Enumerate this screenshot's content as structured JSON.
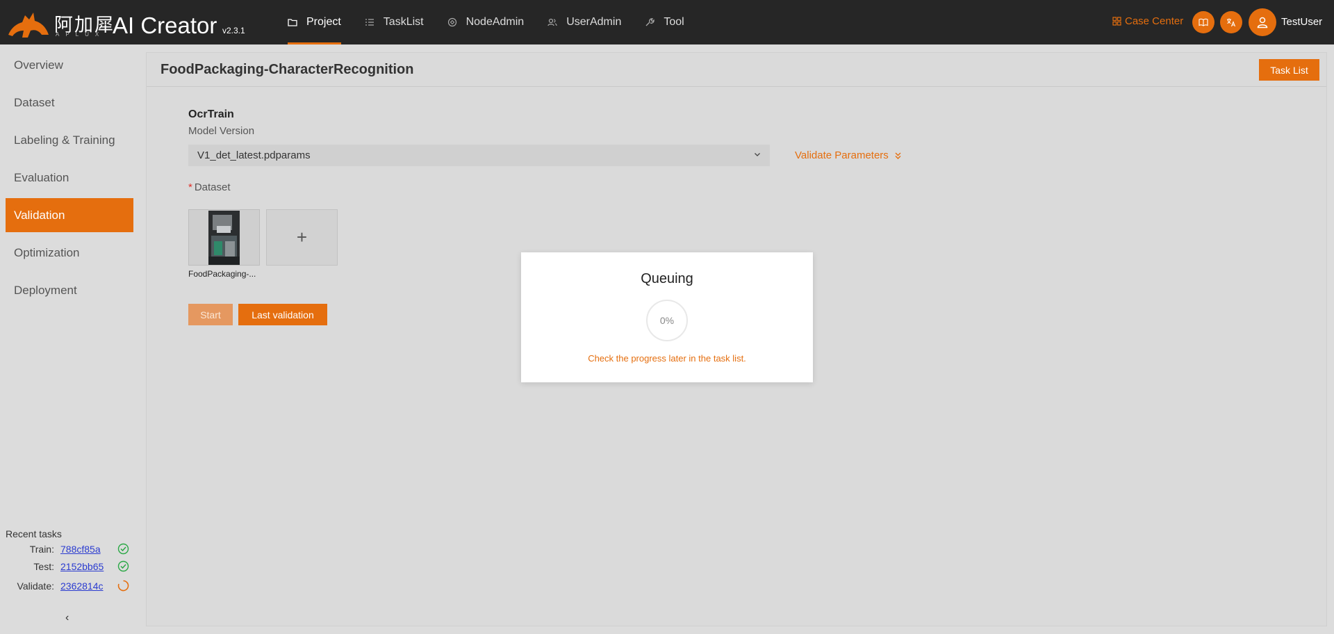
{
  "header": {
    "logo_cn": "阿加犀",
    "logo_sub": "APLUX",
    "app_title": "AI Creator",
    "version": "v2.3.1",
    "nav": [
      {
        "label": "Project",
        "icon": "folder-icon",
        "active": true
      },
      {
        "label": "TaskList",
        "icon": "tasklist-icon",
        "active": false
      },
      {
        "label": "NodeAdmin",
        "icon": "node-icon",
        "active": false
      },
      {
        "label": "UserAdmin",
        "icon": "users-icon",
        "active": false
      },
      {
        "label": "Tool",
        "icon": "wrench-icon",
        "active": false
      }
    ],
    "case_center": "Case Center",
    "username": "TestUser",
    "accent_color": "#e56e0e"
  },
  "sidebar": {
    "items": [
      {
        "label": "Overview"
      },
      {
        "label": "Dataset"
      },
      {
        "label": "Labeling & Training"
      },
      {
        "label": "Evaluation"
      },
      {
        "label": "Validation",
        "active": true
      },
      {
        "label": "Optimization"
      },
      {
        "label": "Deployment"
      }
    ],
    "recent_title": "Recent tasks",
    "recent": [
      {
        "label": "Train:",
        "id": "788cf85a",
        "status": "done"
      },
      {
        "label": "Test:",
        "id": "2152bb65",
        "status": "done"
      },
      {
        "label": "Validate:",
        "id": "2362814c",
        "status": "running"
      }
    ],
    "collapse": "‹"
  },
  "main": {
    "project_title": "FoodPackaging-CharacterRecognition",
    "task_list_button": "Task List",
    "section_title": "OcrTrain",
    "model_version_label": "Model Version",
    "model_version_value": "V1_det_latest.pdparams",
    "validate_params": "Validate Parameters",
    "dataset_required": "*",
    "dataset_label": "Dataset",
    "dataset_caption": "FoodPackaging-...",
    "add_symbol": "+",
    "start_button": "Start",
    "last_validation_button": "Last validation"
  },
  "modal": {
    "title": "Queuing",
    "progress_text": "0%",
    "progress": 0,
    "message": "Check the progress later in the task list."
  }
}
